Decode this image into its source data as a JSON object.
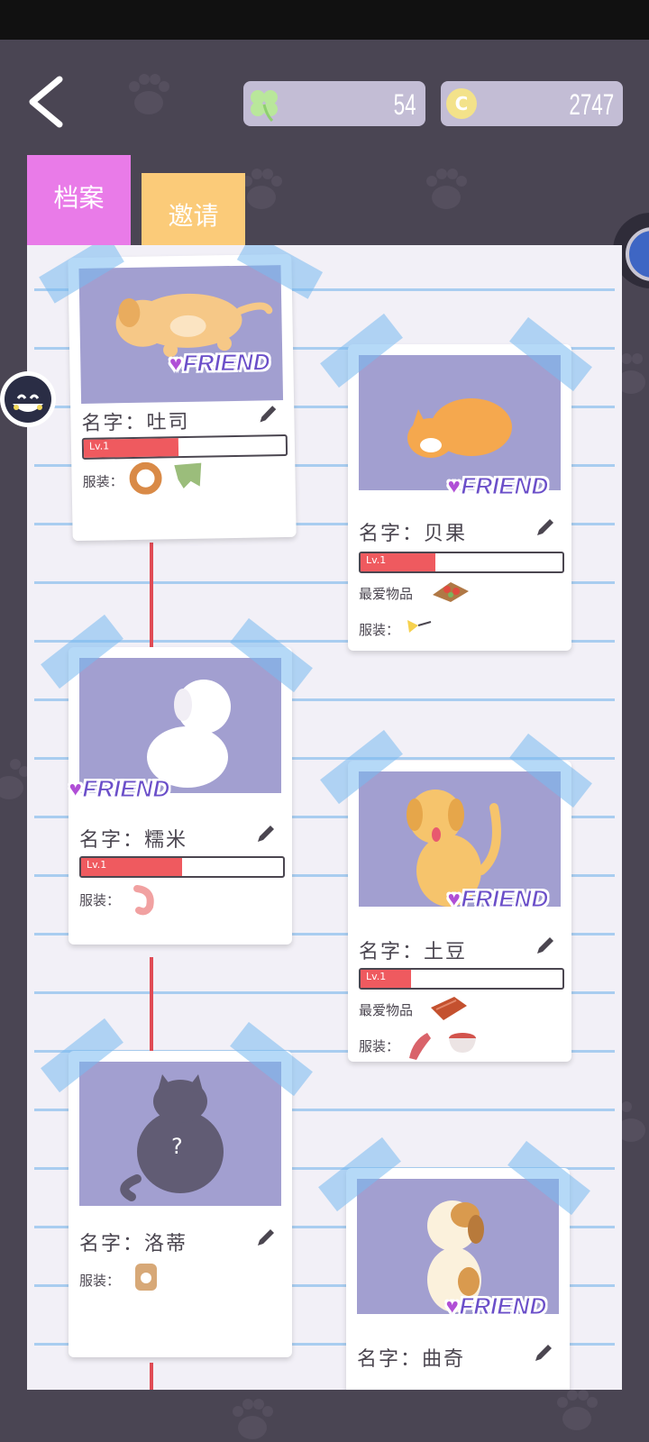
{
  "header": {
    "clover_count": "54",
    "coin_count": "2747",
    "colors": {
      "background": "#4a4553",
      "pill": "#c3bdd5",
      "clover": "#b9e79b",
      "coin": "#f3e28a"
    }
  },
  "tabs": [
    {
      "label": "档案",
      "active": true,
      "color": "#e97be8"
    },
    {
      "label": "邀请",
      "active": false,
      "color": "#fbcb79"
    }
  ],
  "pets": [
    {
      "name_label": "名字：吐司",
      "badge": "FRIEND",
      "level_text": "Lv.1",
      "level_fraction": 0.47,
      "outfit_label": "服装："
    },
    {
      "name_label": "名字：贝果",
      "badge": "FRIEND",
      "level_text": "Lv.1",
      "level_fraction": 0.37,
      "favorite_label": "最爱物品",
      "outfit_label": "服装："
    },
    {
      "name_label": "名字：糯米",
      "badge": "FRIEND",
      "level_text": "Lv.1",
      "level_fraction": 0.5,
      "outfit_label": "服装："
    },
    {
      "name_label": "名字：土豆",
      "badge": "FRIEND",
      "level_text": "Lv.1",
      "level_fraction": 0.25,
      "favorite_label": "最爱物品",
      "outfit_label": "服装："
    },
    {
      "name_label": "名字：洛蒂",
      "mystery": "?",
      "outfit_label": "服装："
    },
    {
      "name_label": "名字：曲奇",
      "badge": "FRIEND"
    }
  ]
}
